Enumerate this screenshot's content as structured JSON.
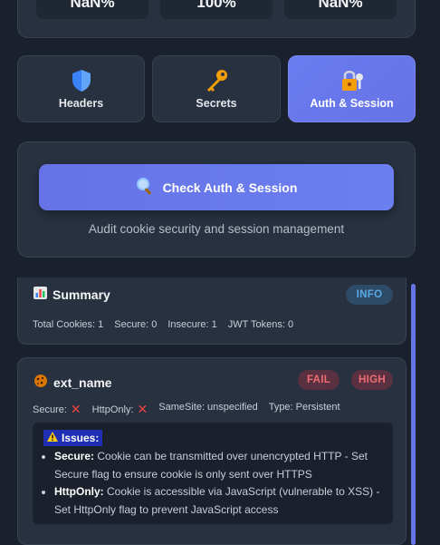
{
  "stats": [
    "NaN%",
    "100%",
    "NaN%"
  ],
  "tabs": [
    {
      "label": "Headers",
      "icon": "shield-icon",
      "active": false
    },
    {
      "label": "Secrets",
      "icon": "key-icon",
      "active": false
    },
    {
      "label": "Auth & Session",
      "icon": "lock-key-icon",
      "active": true
    }
  ],
  "action": {
    "button_label": "Check Auth & Session",
    "button_icon": "magnifier-icon",
    "description": "Audit cookie security and session management"
  },
  "summary": {
    "title": "Summary",
    "icon": "bar-chart-icon",
    "badge": "INFO",
    "stats": {
      "total": "Total Cookies: 1",
      "secure": "Secure: 0",
      "insecure": "Insecure: 1",
      "jwt": "JWT Tokens: 0"
    }
  },
  "cookie": {
    "name": "ext_name",
    "icon": "cookie-icon",
    "status_badge": "FAIL",
    "severity_badge": "HIGH",
    "secure_label": "Secure:",
    "httponly_label": "HttpOnly:",
    "samesite": "SameSite: unspecified",
    "type": "Type: Persistent",
    "issues_title": "Issues:",
    "issues": [
      {
        "key": "Secure:",
        "text": " Cookie can be transmitted over unencrypted HTTP - Set Secure flag to ensure cookie is only sent over HTTPS"
      },
      {
        "key": "HttpOnly:",
        "text": " Cookie is accessible via JavaScript (vulnerable to XSS) - Set HttpOnly flag to prevent JavaScript access"
      }
    ]
  },
  "colors": {
    "accent": "#6673e6",
    "fail": "#f06c74",
    "info": "#5aa9e6"
  }
}
